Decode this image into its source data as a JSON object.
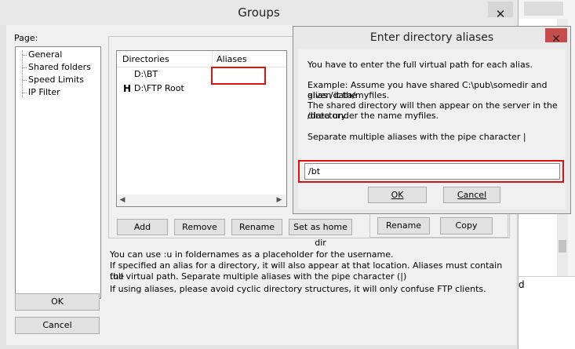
{
  "groups": {
    "title": "Groups",
    "close_glyph": "✕",
    "page_label": "Page:",
    "tree": [
      "General",
      "Shared folders",
      "Speed Limits",
      "IP Filter"
    ],
    "ok_label": "OK",
    "cancel_label": "Cancel",
    "table": {
      "columns": [
        "Directories",
        "Aliases"
      ],
      "rows": [
        {
          "marker": "",
          "directory": "D:\\BT",
          "alias": ""
        },
        {
          "marker": "H",
          "directory": "D:\\FTP Root",
          "alias": ""
        }
      ]
    },
    "buttons": {
      "add": "Add",
      "remove": "Remove",
      "rename": "Rename",
      "home_dir": "Set as home dir",
      "rename2": "Rename",
      "copy": "Copy"
    },
    "notes": [
      "You can use :u in foldernames as a placeholder for the username.",
      "If specified an alias for a directory, it will also appear at that location. Aliases must contain the",
      "full virtual path. Separate multiple aliases with the pipe character (|)",
      "If using aliases, please avoid cyclic directory structures, it will only confuse FTP clients."
    ]
  },
  "dialog": {
    "title": "Enter directory aliases",
    "close_glyph": "✕",
    "text1": "You have to enter the full virtual path for each alias.",
    "text2a": "Example: Assume you have shared C:\\pub\\somedir and given it the",
    "text2b": "alias /data/myfiles.",
    "text3a": "The shared directory will then appear on the server in the directory",
    "text3b": "/data under the name myfiles.",
    "text4": "Separate multiple aliases with the pipe character |",
    "input_value": "/bt",
    "ok_label": "OK",
    "cancel_label": "Cancel"
  },
  "background_window": {
    "column_fragment": "d"
  },
  "colors": {
    "highlight_red": "#e01010",
    "close_red": "#c74d4d"
  }
}
